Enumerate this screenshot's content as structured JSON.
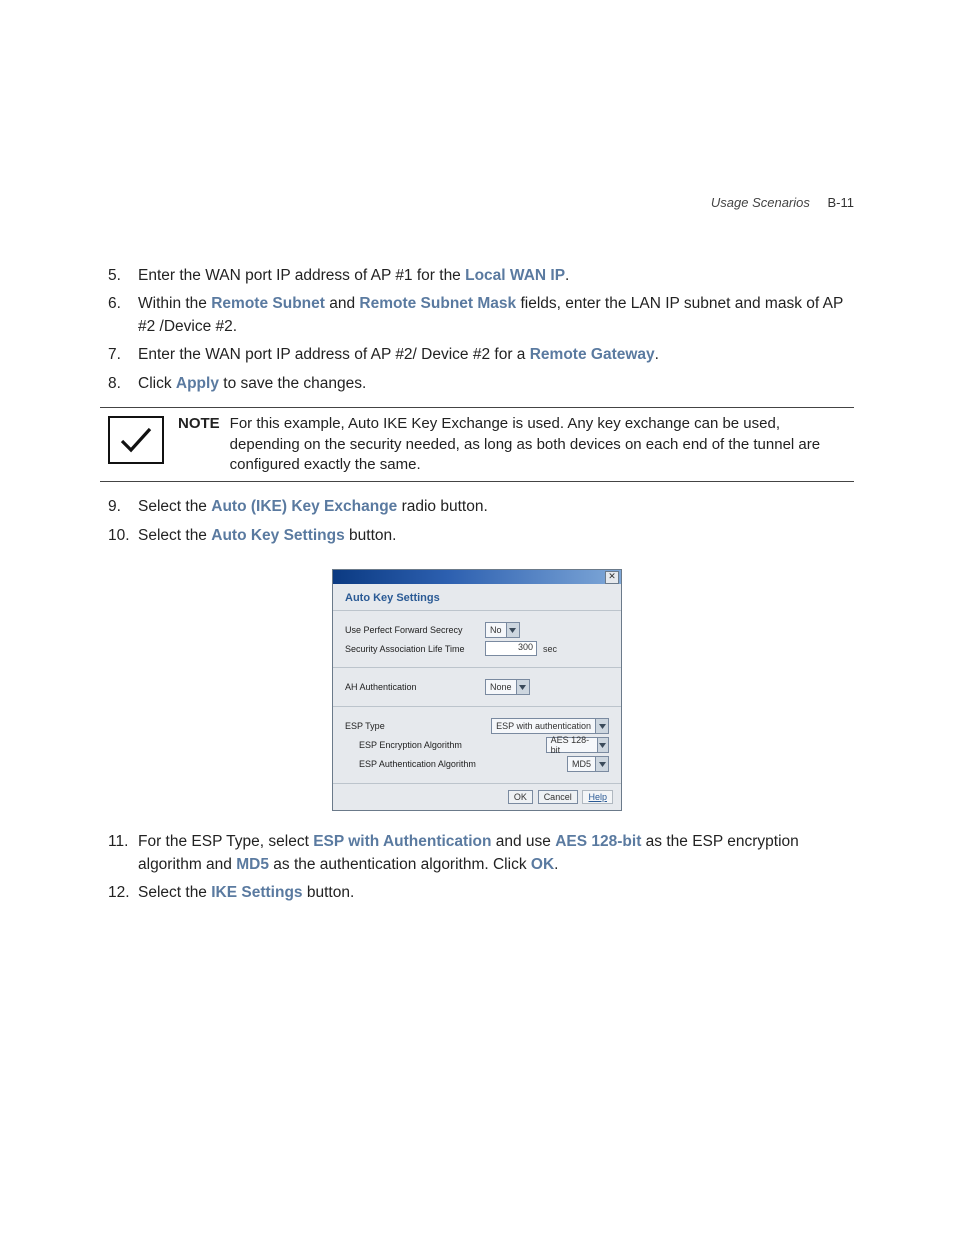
{
  "header": {
    "title": "Usage Scenarios",
    "pageno": "B-11"
  },
  "steps_a": [
    {
      "n": "5.",
      "pre": "Enter the WAN port IP address of AP #1 for the ",
      "b1": "Local WAN IP",
      "post": "."
    },
    {
      "n": "6.",
      "pre": "Within the ",
      "b1": "Remote Subnet",
      "mid1": " and ",
      "b2": "Remote Subnet Mask",
      "post": " fields, enter the LAN IP subnet and mask of AP #2 /Device #2."
    },
    {
      "n": "7.",
      "pre": "Enter the WAN port IP address of AP #2/ Device #2 for a ",
      "b1": "Remote Gateway",
      "post": "."
    },
    {
      "n": "8.",
      "pre": "Click ",
      "b1": "Apply",
      "post": " to save the changes."
    }
  ],
  "note": {
    "label": "NOTE",
    "text": "For this example, Auto IKE Key Exchange is used. Any key exchange can be used, depending on the security needed, as long as both devices on each end of the tunnel are configured exactly the same."
  },
  "steps_b": [
    {
      "n": "9.",
      "pre": "Select the ",
      "b1": "Auto (IKE) Key Exchange",
      "post": " radio button."
    },
    {
      "n": "10.",
      "pre": "Select the ",
      "b1": "Auto Key Settings",
      "post": " button."
    }
  ],
  "dialog": {
    "title": "Auto Key Settings",
    "rows": {
      "pfs_label": "Use Perfect Forward Secrecy",
      "pfs_value": "No",
      "salt_label": "Security Association Life Time",
      "salt_value": "300",
      "salt_unit": "sec",
      "ah_label": "AH Authentication",
      "ah_value": "None",
      "esp_type_label": "ESP Type",
      "esp_type_value": "ESP with authentication",
      "esp_enc_label": "ESP Encryption Algorithm",
      "esp_enc_value": "AES 128-bit",
      "esp_auth_label": "ESP Authentication Algorithm",
      "esp_auth_value": "MD5"
    },
    "buttons": {
      "ok": "OK",
      "cancel": "Cancel",
      "help": "Help"
    }
  },
  "steps_c": [
    {
      "n": "11.",
      "pre": "For the ESP Type, select ",
      "b1": "ESP with Authentication",
      "mid1": " and use ",
      "b2": "AES 128-bit",
      "mid2": " as the ESP encryption algorithm and ",
      "b3": "MD5",
      "post": " as the authentication algorithm. Click ",
      "b4": "OK",
      "post2": "."
    },
    {
      "n": "12.",
      "pre": "Select the ",
      "b1": "IKE Settings",
      "post": " button."
    }
  ]
}
